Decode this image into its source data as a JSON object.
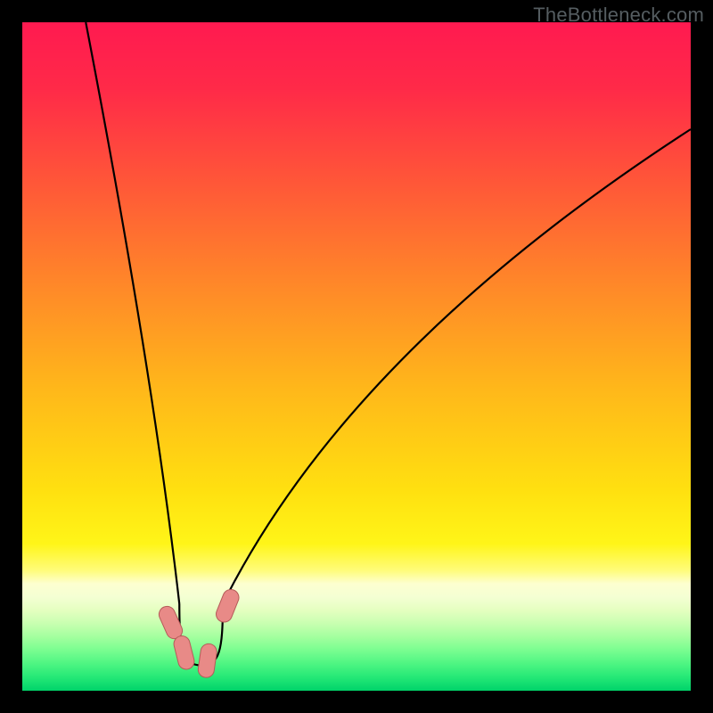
{
  "watermark": "TheBottleneck.com",
  "gradient_stops": [
    {
      "offset": 0.0,
      "color": "#ff1a50"
    },
    {
      "offset": 0.1,
      "color": "#ff2a48"
    },
    {
      "offset": 0.25,
      "color": "#ff5a37"
    },
    {
      "offset": 0.4,
      "color": "#ff8a28"
    },
    {
      "offset": 0.55,
      "color": "#ffb81a"
    },
    {
      "offset": 0.7,
      "color": "#ffe010"
    },
    {
      "offset": 0.78,
      "color": "#fff518"
    },
    {
      "offset": 0.82,
      "color": "#fffc7a"
    },
    {
      "offset": 0.84,
      "color": "#fdffd0"
    },
    {
      "offset": 0.86,
      "color": "#f4ffd3"
    },
    {
      "offset": 0.88,
      "color": "#e4ffc0"
    },
    {
      "offset": 0.9,
      "color": "#c7ffb0"
    },
    {
      "offset": 0.92,
      "color": "#a2ff9e"
    },
    {
      "offset": 0.94,
      "color": "#78fd90"
    },
    {
      "offset": 0.96,
      "color": "#4df582"
    },
    {
      "offset": 0.98,
      "color": "#24e876"
    },
    {
      "offset": 1.0,
      "color": "#00d36a"
    }
  ],
  "trough": {
    "x_center_frac": 0.268,
    "bottom_y_frac": 0.962,
    "joint_y_frac": 0.87,
    "left_right_spread_frac": 0.033,
    "bead_half_width": 9,
    "bead_half_height": 19,
    "bead_rx": 9,
    "bead_color": "#e88a87",
    "bead_stroke": "#b55a58"
  },
  "chart_data": {
    "type": "line",
    "title": "",
    "xlabel": "",
    "ylabel": "",
    "description": "Bottleneck-style V-shaped curve. Two black limbs meet near a trough around x≈0.27 (fraction of plot width). Left limb rises steeply to the top-left; right limb rises more gradually toward the top-right but does not reach the very top edge. Background is a vertical rainbow gradient (red at top → green at bottom). A short cluster of rounded salmon-colored beads sits along the curve near the trough.",
    "x_domain_frac": [
      0.0,
      1.0
    ],
    "y_domain_frac": [
      0.0,
      1.0
    ],
    "series": [
      {
        "name": "left-limb",
        "points_frac": [
          {
            "x": 0.095,
            "y": 0.0
          },
          {
            "x": 0.235,
            "y": 0.87
          }
        ],
        "control_frac": {
          "x": 0.195,
          "y": 0.52
        }
      },
      {
        "name": "right-limb",
        "points_frac": [
          {
            "x": 0.3,
            "y": 0.87
          },
          {
            "x": 1.0,
            "y": 0.16
          }
        ],
        "control_frac": {
          "x": 0.49,
          "y": 0.49
        }
      },
      {
        "name": "trough-base",
        "points_frac": [
          {
            "x": 0.235,
            "y": 0.87
          },
          {
            "x": 0.24,
            "y": 0.94
          },
          {
            "x": 0.268,
            "y": 0.962
          },
          {
            "x": 0.295,
            "y": 0.94
          },
          {
            "x": 0.3,
            "y": 0.87
          }
        ]
      }
    ],
    "beads_on_curve_frac": [
      {
        "x": 0.222,
        "y": 0.898
      },
      {
        "x": 0.242,
        "y": 0.943
      },
      {
        "x": 0.277,
        "y": 0.955
      },
      {
        "x": 0.307,
        "y": 0.873
      }
    ]
  }
}
